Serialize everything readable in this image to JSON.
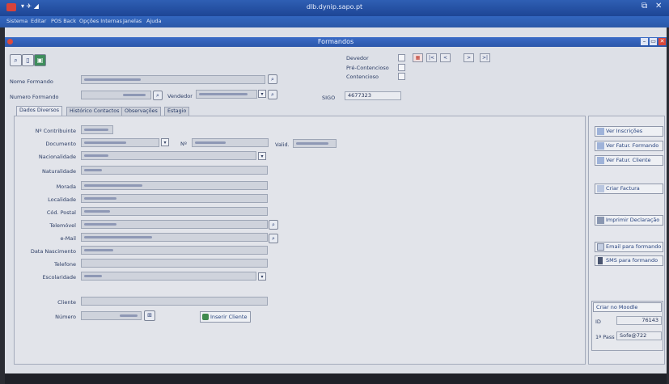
{
  "window": {
    "title": "dlb.dynip.sapo.pt"
  },
  "menu": {
    "items": [
      "Sistema",
      "Editar",
      "POS Back",
      "Opções Internas",
      "Janelas",
      "Ajuda"
    ]
  },
  "form": {
    "title": "Formandos"
  },
  "header": {
    "nome_formando_label": "Nome Formando",
    "numero_formando_label": "Numero Formando",
    "vendedor_label": "Vendedor",
    "sigo_label": "SIGO",
    "sigo_value": "4677323",
    "devedor_label": "Devedor",
    "pre_contencioso_label": "Pré-Contencioso",
    "contencioso_label": "Contencioso"
  },
  "nav": {
    "first": "|<",
    "prev": "<",
    "next": ">",
    "last": ">|"
  },
  "tabs": [
    "Dados Diversos",
    "Histórico Contactos",
    "Observações",
    "Estagio"
  ],
  "fields": {
    "contribuinte_label": "Nº Contribuinte",
    "documento_label": "Documento",
    "doc_numero_label": "Nº",
    "valid_label": "Valid.",
    "nacionalidade_label": "Nacionalidade",
    "naturalidade_label": "Naturalidade",
    "morada_label": "Morada",
    "localidade_label": "Localidade",
    "cod_postal_label": "Cód. Postal",
    "telemovel_label": "Telemóvel",
    "email_label": "e-Mail",
    "data_nascimento_label": "Data Nascimento",
    "telefone_label": "Telefone",
    "escolaridade_label": "Escolaridade",
    "cliente_label": "Cliente",
    "numero_label": "Número"
  },
  "buttons": {
    "inserir_cliente": "Inserir Cliente",
    "ver_inscricoes": "Ver Inscrições",
    "ver_fatur_formando": "Ver Fatur. Formando",
    "ver_fatur_cliente": "Ver Fatur. Cliente",
    "criar_factura": "Criar Factura",
    "imprimir_declaracao": "Imprimir Declaração",
    "email_formando": "Email para formando",
    "sms_formando": "SMS para formando"
  },
  "moodle": {
    "title": "Criar no Moodle",
    "id_label": "ID",
    "id_value": "76143",
    "pass_label": "1ª Pass",
    "pass_value": "Sofe@722"
  },
  "colors": {
    "titlebar": "#2f5fb4",
    "form_bg": "#dde0e7",
    "accent_red": "#c0392b"
  }
}
